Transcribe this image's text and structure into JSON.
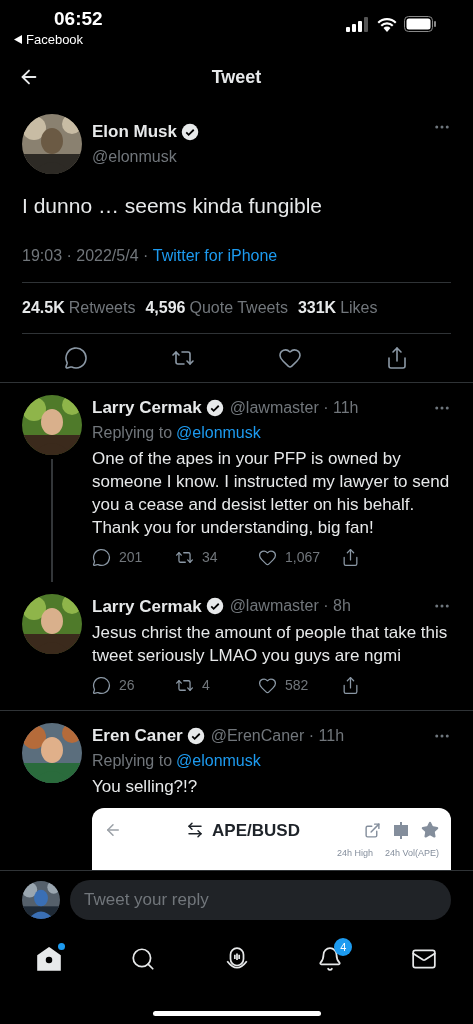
{
  "status_bar": {
    "time": "06:52",
    "back_app": "Facebook"
  },
  "header": {
    "title": "Tweet"
  },
  "tweet": {
    "name": "Elon Musk",
    "verified": true,
    "handle": "@elonmusk",
    "text": "I dunno … seems kinda fungible",
    "timestamp": "19:03 · 2022/5/4 · ",
    "source": "Twitter for iPhone",
    "stats": [
      {
        "count": "24.5K",
        "label": "Retweets"
      },
      {
        "count": "4,596",
        "label": "Quote Tweets"
      },
      {
        "count": "331K",
        "label": "Likes"
      }
    ]
  },
  "replies": [
    {
      "name": "Larry Cermak",
      "verified": true,
      "handle": "@lawmaster · 11h",
      "replying_prefix": "Replying to",
      "replying_to": "@elonmusk",
      "text": "One of the apes in your PFP is owned by someone I know. I instructed my lawyer to send you a cease and desist letter on his behalf. Thank you for understanding, big fan!",
      "counts": {
        "replies": "201",
        "retweets": "34",
        "likes": "1,067"
      },
      "thread_continues": true
    },
    {
      "name": "Larry Cermak",
      "verified": true,
      "handle": "@lawmaster · 8h",
      "text": "Jesus christ the amount of people that take this tweet seriously LMAO you guys are ngmi",
      "counts": {
        "replies": "26",
        "retweets": "4",
        "likes": "582"
      },
      "thread_continues": false
    },
    {
      "name": "Eren Caner",
      "verified": true,
      "handle": "@ErenCaner · 11h",
      "replying_prefix": "Replying to",
      "replying_to": "@elonmusk",
      "text": "You selling?!?",
      "thread_continues": false,
      "attachment": {
        "kind": "screenshot",
        "pair": "APE/BUSD",
        "labels": [
          "24h High",
          "24h Vol(APE)"
        ]
      }
    }
  ],
  "reply_box": {
    "placeholder": "Tweet your reply"
  },
  "tab_bar": [
    {
      "kind": "home",
      "selected": true,
      "dot": true
    },
    {
      "kind": "search",
      "selected": false
    },
    {
      "kind": "spaces",
      "selected": false
    },
    {
      "kind": "notifications",
      "selected": false,
      "badge": "4"
    },
    {
      "kind": "messages",
      "selected": false
    }
  ]
}
